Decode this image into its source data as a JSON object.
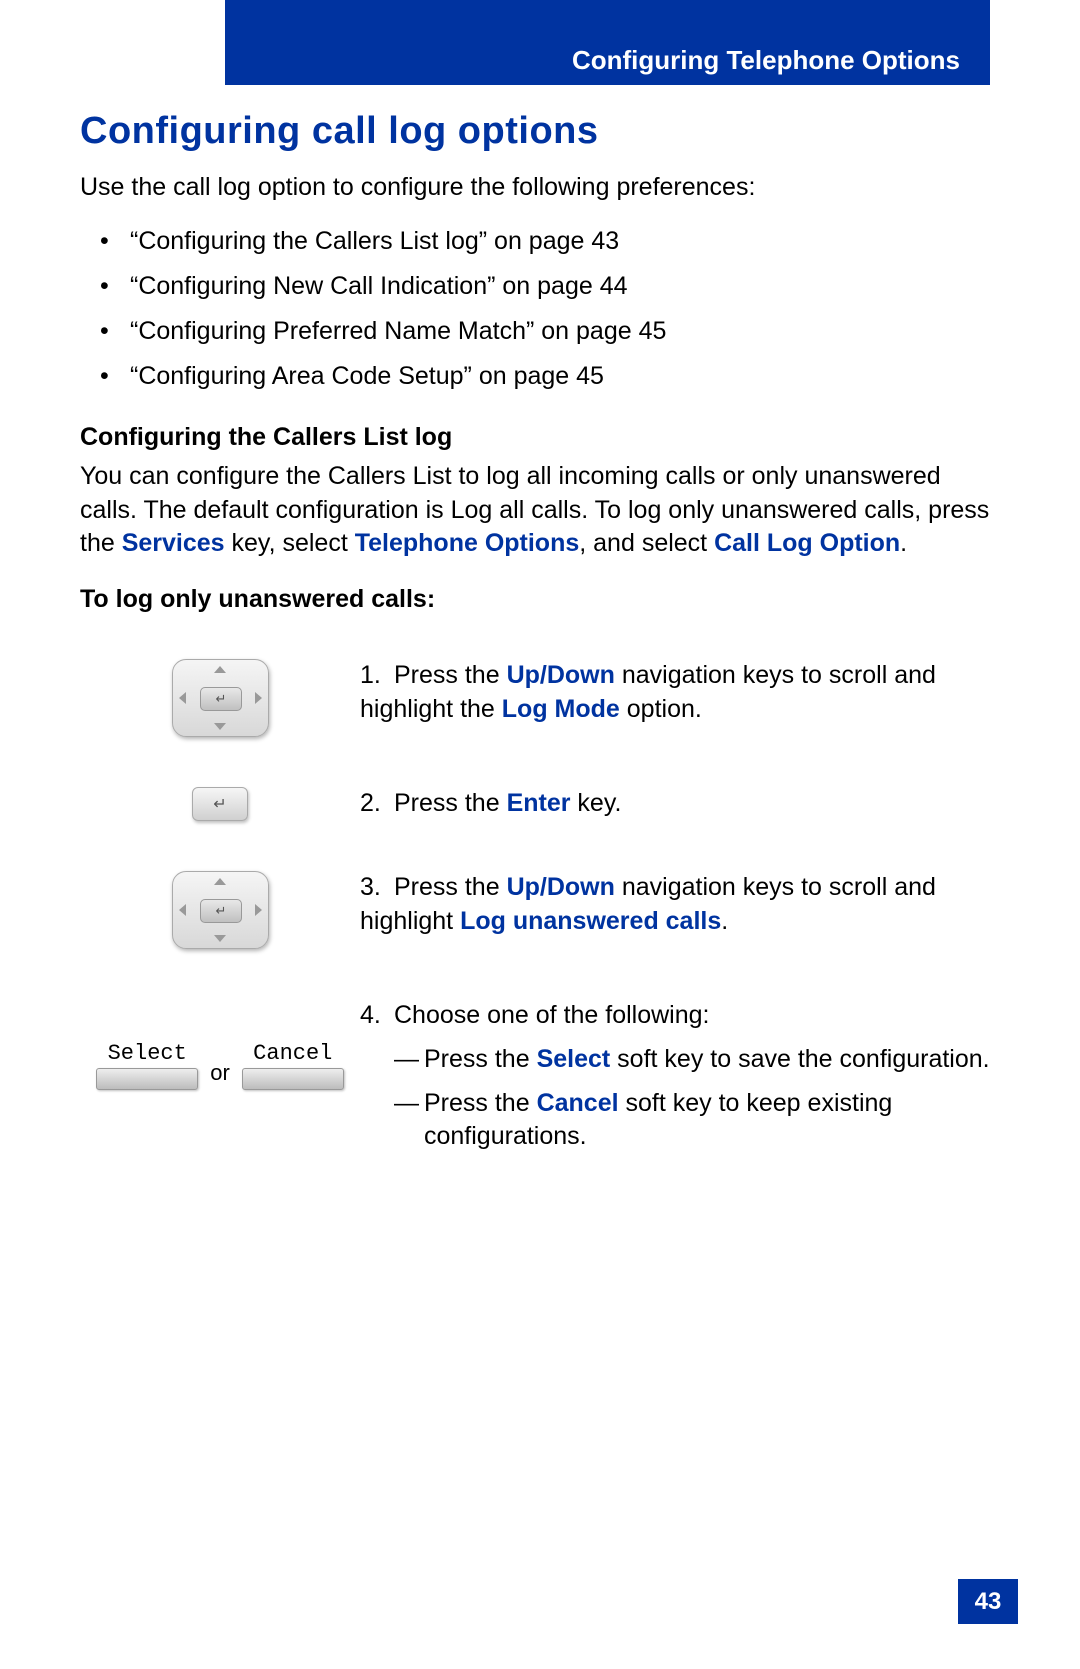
{
  "header": {
    "running_title": "Configuring Telephone Options"
  },
  "title": "Configuring call log options",
  "intro": "Use the call log option to configure the following preferences:",
  "bullets": [
    "“Configuring the Callers List log” on page 43",
    "“Configuring New Call Indication” on page 44",
    "“Configuring Preferred Name Match” on page 45",
    "“Configuring Area Code Setup” on page 45"
  ],
  "section1": {
    "heading": "Configuring the Callers List log",
    "body_pre": "You can configure the Callers List to log all incoming calls or only unanswered calls. The default configuration is Log all calls. To log only unanswered calls, press the ",
    "hl_services": "Services",
    "body_mid1": " key, select ",
    "hl_teloptions": "Telephone Options",
    "body_mid2": ", and select ",
    "hl_calllog": "Call Log Option",
    "body_end": "."
  },
  "proc_heading": "To log only unanswered calls:",
  "steps": {
    "s1": {
      "num": "1.",
      "pre": "Press the ",
      "hl1": "Up/Down",
      "mid": " navigation keys to scroll and highlight the ",
      "hl2": "Log Mode",
      "post": " option."
    },
    "s2": {
      "num": "2.",
      "pre": "Press the ",
      "hl1": "Enter",
      "post": " key."
    },
    "s3": {
      "num": "3.",
      "pre": "Press the ",
      "hl1": "Up/Down",
      "mid": " navigation keys to scroll and highlight ",
      "hl2": "Log unanswered calls",
      "post": "."
    },
    "s4": {
      "num": "4.",
      "intro": "Choose one of the following:",
      "opt_a_pre": "Press the ",
      "opt_a_hl": "Select",
      "opt_a_post": " soft key to save the configuration.",
      "opt_b_pre": "Press the ",
      "opt_b_hl": "Cancel",
      "opt_b_post": " soft key to keep existing configurations."
    }
  },
  "softkeys": {
    "select": "Select",
    "cancel": "Cancel",
    "or": "or"
  },
  "page_number": "43"
}
